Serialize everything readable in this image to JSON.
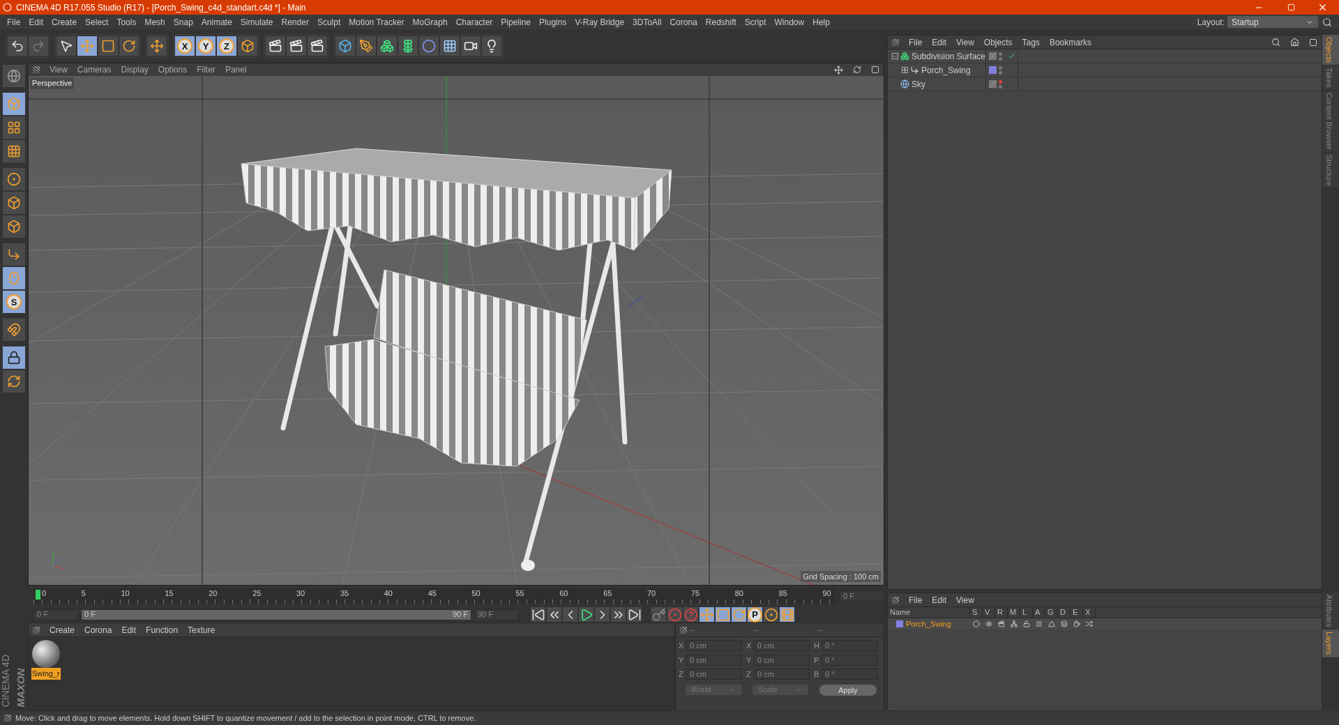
{
  "window": {
    "title": "CINEMA 4D R17.055 Studio (R17) - [Porch_Swing_c4d_standart.c4d *] - Main"
  },
  "menu": [
    "File",
    "Edit",
    "Create",
    "Select",
    "Tools",
    "Mesh",
    "Snap",
    "Animate",
    "Simulate",
    "Render",
    "Sculpt",
    "Motion Tracker",
    "MoGraph",
    "Character",
    "Pipeline",
    "Plugins",
    "V-Ray Bridge",
    "3DToAll",
    "Corona",
    "Redshift",
    "Script",
    "Window",
    "Help"
  ],
  "layout": {
    "label": "Layout:",
    "value": "Startup"
  },
  "top_toolbar": [
    [
      {
        "kind": "undo",
        "selected": false
      },
      {
        "kind": "redo",
        "selected": false
      }
    ],
    [
      {
        "kind": "select",
        "selected": false
      },
      {
        "kind": "move",
        "selected": true
      },
      {
        "kind": "scale",
        "selected": false
      },
      {
        "kind": "rotate",
        "selected": false
      }
    ],
    [
      {
        "kind": "transform",
        "selected": false
      }
    ],
    [
      {
        "kind": "axis",
        "label": "X",
        "selected": true
      },
      {
        "kind": "axis",
        "label": "Y",
        "selected": true
      },
      {
        "kind": "axis",
        "label": "Z",
        "selected": true
      },
      {
        "kind": "coord",
        "selected": false
      }
    ],
    [
      {
        "kind": "render-view",
        "selected": false
      },
      {
        "kind": "render",
        "selected": false
      },
      {
        "kind": "render-settings",
        "selected": false
      }
    ],
    [
      {
        "kind": "cube",
        "selected": false
      },
      {
        "kind": "pen",
        "selected": false
      },
      {
        "kind": "subdivision",
        "selected": false
      },
      {
        "kind": "cloner",
        "selected": false
      },
      {
        "kind": "deformer",
        "selected": false
      },
      {
        "kind": "floor",
        "selected": false
      },
      {
        "kind": "camera",
        "selected": false
      },
      {
        "kind": "light",
        "selected": false
      }
    ]
  ],
  "left_toolbar": [
    [
      {
        "kind": "globe",
        "selected": false
      }
    ],
    [
      {
        "kind": "model",
        "selected": true
      },
      {
        "kind": "texture",
        "selected": false
      },
      {
        "kind": "workplane",
        "selected": false
      }
    ],
    [
      {
        "kind": "points",
        "selected": false
      },
      {
        "kind": "edges",
        "selected": false
      },
      {
        "kind": "polygons",
        "selected": false
      }
    ],
    [
      {
        "kind": "axis",
        "selected": false
      },
      {
        "kind": "tweak",
        "selected": true
      },
      {
        "kind": "snap",
        "label": "S",
        "selected": true
      }
    ],
    [
      {
        "kind": "magnet",
        "selected": false
      }
    ],
    [
      {
        "kind": "grid-lock",
        "selected": true
      },
      {
        "kind": "grid-rotate",
        "selected": false
      }
    ]
  ],
  "logo": {
    "brand": "MAXON",
    "product": "CINEMA 4D"
  },
  "viewport": {
    "menu": [
      "View",
      "Cameras",
      "Display",
      "Options",
      "Filter",
      "Panel"
    ],
    "camera": "Perspective",
    "grid_spacing": "Grid Spacing : 100 cm"
  },
  "timeline": {
    "ticks": [
      "0",
      "5",
      "10",
      "15",
      "20",
      "25",
      "30",
      "35",
      "40",
      "45",
      "50",
      "55",
      "60",
      "65",
      "70",
      "75",
      "80",
      "85",
      "90"
    ],
    "playhead": {
      "level": 0
    },
    "current": "0 F"
  },
  "transport": {
    "start": "0 F",
    "range": {
      "level": 1
    },
    "range_start": "0 F",
    "range_end": "90 F",
    "end": "90 F",
    "buttons": [
      {
        "kind": "first",
        "selected": false
      },
      {
        "kind": "prev-key",
        "selected": false
      },
      {
        "kind": "prev",
        "selected": false
      },
      {
        "kind": "play",
        "selected": false
      },
      {
        "kind": "next",
        "selected": false
      },
      {
        "kind": "next-key",
        "selected": false
      },
      {
        "kind": "last",
        "selected": false
      }
    ],
    "keys": [
      {
        "kind": "key",
        "selected": false
      },
      {
        "kind": "record",
        "selected": false
      },
      {
        "kind": "autokey",
        "selected": false
      },
      {
        "kind": "move",
        "selected": true
      },
      {
        "kind": "scale",
        "selected": true
      },
      {
        "kind": "rotate",
        "selected": true
      },
      {
        "kind": "param",
        "label": "P",
        "selected": true
      },
      {
        "kind": "points",
        "selected": false
      },
      {
        "kind": "film",
        "selected": true
      }
    ]
  },
  "materials": {
    "menu": [
      "Create",
      "Corona",
      "Edit",
      "Function",
      "Texture"
    ],
    "items": [
      {
        "name": "Swing_r",
        "selected": true
      }
    ]
  },
  "coordinates": {
    "headers": [
      "--",
      "--",
      "--"
    ],
    "rows": [
      [
        {
          "axis": "X",
          "value": "0 cm"
        },
        {
          "axis": "X",
          "value": "0 cm"
        },
        {
          "axis": "H",
          "value": "0 °"
        }
      ],
      [
        {
          "axis": "Y",
          "value": "0 cm"
        },
        {
          "axis": "Y",
          "value": "0 cm"
        },
        {
          "axis": "P",
          "value": "0 °"
        }
      ],
      [
        {
          "axis": "Z",
          "value": "0 cm"
        },
        {
          "axis": "Z",
          "value": "0 cm"
        },
        {
          "axis": "B",
          "value": "0 °"
        }
      ]
    ],
    "dropdowns": [
      "World",
      "Scale"
    ],
    "apply": "Apply"
  },
  "objects": {
    "menu": [
      "File",
      "Edit",
      "View",
      "Objects",
      "Tags",
      "Bookmarks"
    ],
    "tree": [
      {
        "name": "Subdivision Surface",
        "kind": "subdivision",
        "expanded": true,
        "editor_visible": true,
        "enabled": true,
        "children": [
          {
            "name": "Porch_Swing",
            "kind": "null",
            "expanded": false,
            "editor_visible": true,
            "color": "#8080e0"
          }
        ]
      },
      {
        "name": "Sky",
        "kind": "sky",
        "editor_visible": false
      }
    ]
  },
  "right_tabs": [
    {
      "label": "Objects",
      "selected": true
    },
    {
      "label": "Takes",
      "selected": false
    },
    {
      "label": "Content Browser",
      "selected": false
    },
    {
      "label": "Structure",
      "selected": false
    }
  ],
  "layers": {
    "menu": [
      "File",
      "Edit",
      "View"
    ],
    "columns": [
      "Name",
      "S",
      "V",
      "R",
      "M",
      "L",
      "A",
      "G",
      "D",
      "E",
      "X"
    ],
    "rows": [
      {
        "name": "Porch_Swing",
        "color": "#8080e0"
      }
    ]
  },
  "layer_tabs": [
    {
      "label": "Attributes",
      "selected": false
    },
    {
      "label": "Layers",
      "selected": true
    }
  ],
  "status": "Move: Click and drag to move elements. Hold down SHIFT to quantize movement / add to the selection in point mode, CTRL to remove."
}
